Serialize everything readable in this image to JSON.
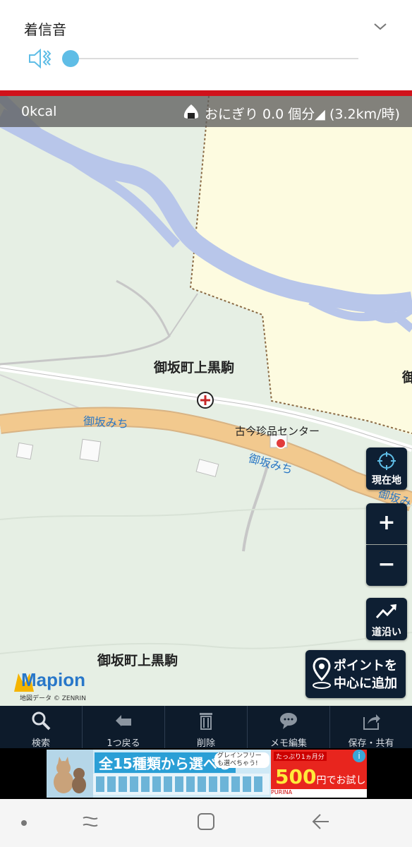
{
  "volume_panel": {
    "title": "着信音",
    "slider_level": 0.0
  },
  "calorie_bar": {
    "kcal": "0kcal",
    "riceball_text": "おにぎり 0.0 個分◢ (3.2km/時)"
  },
  "map": {
    "labels": {
      "area_label_1": "御坂町上黒駒",
      "area_label_2": "御坂町上黒駒",
      "area_label_edge": "御",
      "road_label_1": "御坂みち",
      "road_label_2": "御坂みち",
      "road_label_edge": "御坂み",
      "poi_label": "古今珍品センター"
    },
    "controls": {
      "current_location": "現在地",
      "zoom_in": "+",
      "zoom_out": "−",
      "along_road": "道沿い",
      "add_point": "ポイントを\n中心に追加"
    },
    "logo": "Mapion",
    "credit": "地図データ © ZENRIN"
  },
  "toolbar": {
    "items": [
      {
        "label": "検索",
        "icon": "magnifier-icon"
      },
      {
        "label": "1つ戻る",
        "icon": "back-arrow-icon"
      },
      {
        "label": "削除",
        "icon": "trash-icon"
      },
      {
        "label": "メモ編集",
        "icon": "speech-bubble-icon"
      },
      {
        "label": "保存・共有",
        "icon": "share-icon"
      }
    ]
  },
  "ad": {
    "headline": "全15種類から選べる",
    "grain_free": "グレインフリーも選べちゃう!",
    "ribbon": "たっぷり1ヵ月分",
    "price": "500",
    "price_suffix": "円でお試し",
    "brand": "PURINA",
    "info": "i"
  },
  "colors": {
    "red_bar": "#d0121b",
    "map_forest": "#e6efe4",
    "map_yellow_zone": "#fdfbe0",
    "river": "#b8c6ea",
    "main_road": "#f2c98e",
    "control_bg": "#0e1f33",
    "toolbar_bg": "#0d1b2b",
    "slider_thumb": "#5fbde6"
  }
}
